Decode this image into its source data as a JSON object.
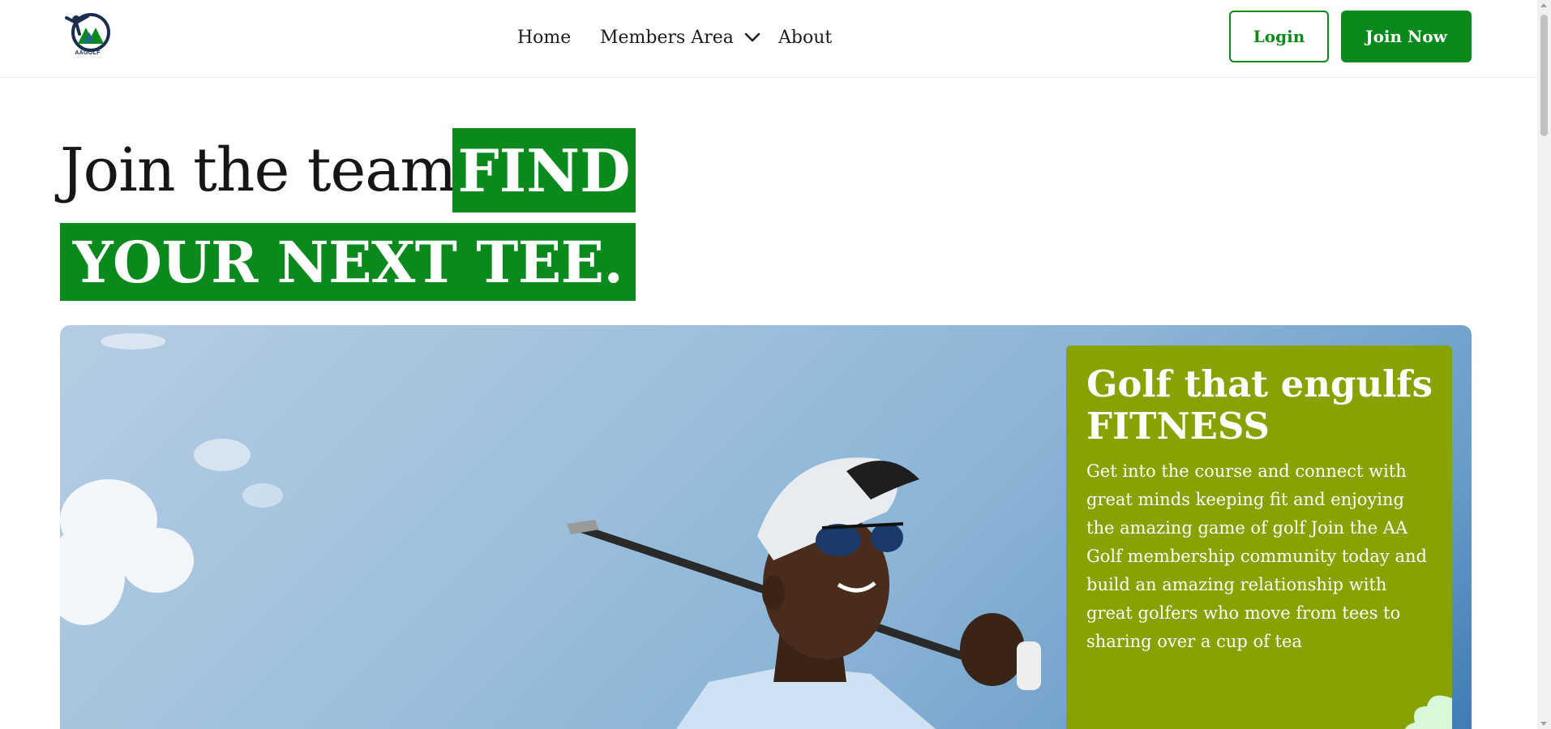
{
  "header": {
    "logo_text": "AAGOLF",
    "nav": [
      {
        "label": "Home"
      },
      {
        "label": "Members Area"
      },
      {
        "label": "About"
      }
    ],
    "login_label": "Login",
    "join_label": "Join Now"
  },
  "hero": {
    "line1_plain": "Join the team.",
    "line1_highlight": "FIND",
    "line2_highlight": "YOUR NEXT TEE."
  },
  "card": {
    "title": "Golf that engulfs FITNESS",
    "body": "Get into the course and connect with great minds keeping fit and enjoying the amazing game of golf Join the AA Golf membership community today and build an amazing relationship with great golfers who move from tees to sharing over a cup of tea"
  },
  "colors": {
    "brand_green": "#0a8a1c",
    "card_olive": "#86a302",
    "blob_mint": "#d9f7d9"
  },
  "icons": {
    "members_dropdown": "chevron-down-icon",
    "logo": "golfer-logo-icon"
  }
}
